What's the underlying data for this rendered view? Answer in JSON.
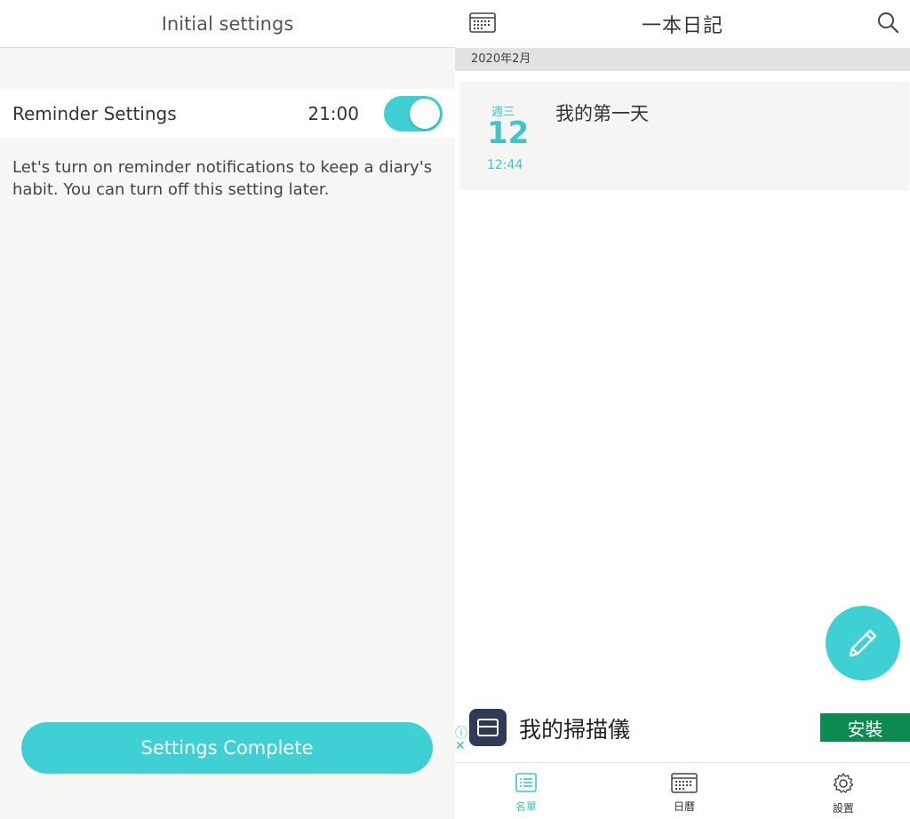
{
  "left": {
    "header_title": "Initial settings",
    "reminder_label": "Reminder Settings",
    "reminder_time": "21:00",
    "reminder_enabled": true,
    "description": "Let's turn on reminder notifications to keep a diary's habit. You can turn off this setting later.",
    "complete_button": "Settings Complete"
  },
  "right": {
    "header_title": "一本日記",
    "month_label": "2020年2月",
    "entry": {
      "weekday": "週三",
      "day": "12",
      "time": "12:44",
      "title": "我的第一天"
    },
    "ad": {
      "title": "我的掃描儀",
      "install_button": "安裝"
    },
    "tabs": [
      {
        "label": "名單",
        "icon": "list-icon",
        "active": true
      },
      {
        "label": "日曆",
        "icon": "calendar-icon",
        "active": false
      },
      {
        "label": "設置",
        "icon": "gear-icon",
        "active": false
      }
    ]
  },
  "colors": {
    "accent": "#3fd0d4",
    "install_green": "#0b8a52"
  }
}
